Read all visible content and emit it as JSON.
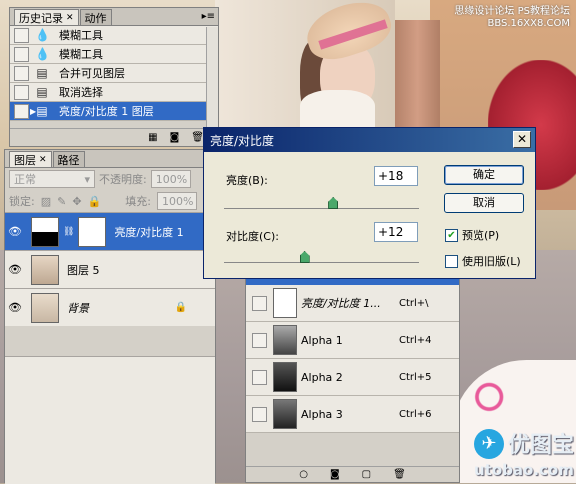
{
  "watermark": {
    "line1": "思缘设计论坛",
    "line2": "PS教程论坛",
    "line3": "BBS.16XX8.COM"
  },
  "logo": {
    "title": "优图宝",
    "url": "utobao.com"
  },
  "history": {
    "tabs": [
      {
        "label": "历史记录"
      },
      {
        "label": "动作"
      }
    ],
    "items": [
      {
        "label": "模糊工具",
        "icon": "blur-drop-icon"
      },
      {
        "label": "模糊工具",
        "icon": "blur-drop-icon"
      },
      {
        "label": "合并可见图层",
        "icon": "document-icon"
      },
      {
        "label": "取消选择",
        "icon": "document-icon"
      },
      {
        "label": "亮度/对比度 1 图层",
        "icon": "document-icon",
        "selected": true
      }
    ]
  },
  "layers": {
    "tabs": [
      {
        "label": "图层"
      },
      {
        "label": "路径"
      }
    ],
    "blend_mode": "正常",
    "opacity_label": "不透明度:",
    "opacity_value": "100%",
    "lock_label": "锁定:",
    "fill_label": "填充:",
    "fill_value": "100%",
    "items": [
      {
        "name": "亮度/对比度 1",
        "selected": true
      },
      {
        "name": "图层 5"
      },
      {
        "name": "背景"
      }
    ]
  },
  "channels": {
    "items": [
      {
        "name": "亮度/对比度 1...",
        "shortcut": "Ctrl+\\"
      },
      {
        "name": "Alpha 1",
        "shortcut": "Ctrl+4"
      },
      {
        "name": "Alpha 2",
        "shortcut": "Ctrl+5"
      },
      {
        "name": "Alpha 3",
        "shortcut": "Ctrl+6"
      }
    ]
  },
  "dialog": {
    "title": "亮度/对比度",
    "brightness_label": "亮度(B):",
    "brightness_value": "+18",
    "contrast_label": "对比度(C):",
    "contrast_value": "+12",
    "ok_label": "确定",
    "cancel_label": "取消",
    "preview_label": "预览(P)",
    "preview_checked": true,
    "legacy_label": "使用旧版(L)",
    "legacy_checked": false
  }
}
